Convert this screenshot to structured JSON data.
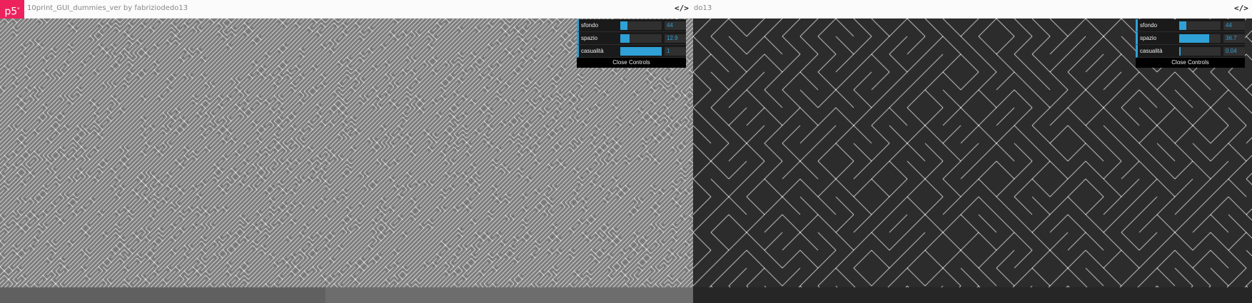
{
  "logo_text": "p5",
  "logo_sup": "*",
  "code_icon_text": "</>",
  "left": {
    "title": "10print_GUI_dummies_ver by fabriziodedo13",
    "background": "#7b7b7b",
    "bottom_band": "#606060",
    "bottom_band_split": "#6d6d6d",
    "line_color": "#ffffff",
    "controls": [
      {
        "label": "sfondo",
        "value": "44",
        "fill": 0.17
      },
      {
        "label": "spazio",
        "value": "12.9",
        "fill": 0.22
      },
      {
        "label": "casualità",
        "value": "1",
        "fill": 1.0
      }
    ],
    "close_label": "Close Controls"
  },
  "right": {
    "title": "do13",
    "background": "#2c2c2c",
    "bottom_band": "#262626",
    "line_color": "#ffffff",
    "controls": [
      {
        "label": "sfondo",
        "value": "44",
        "fill": 0.17
      },
      {
        "label": "spazio",
        "value": "36.7",
        "fill": 0.72
      },
      {
        "label": "casualità",
        "value": "0.04",
        "fill": 0.04
      }
    ],
    "close_label": "Close Controls"
  }
}
